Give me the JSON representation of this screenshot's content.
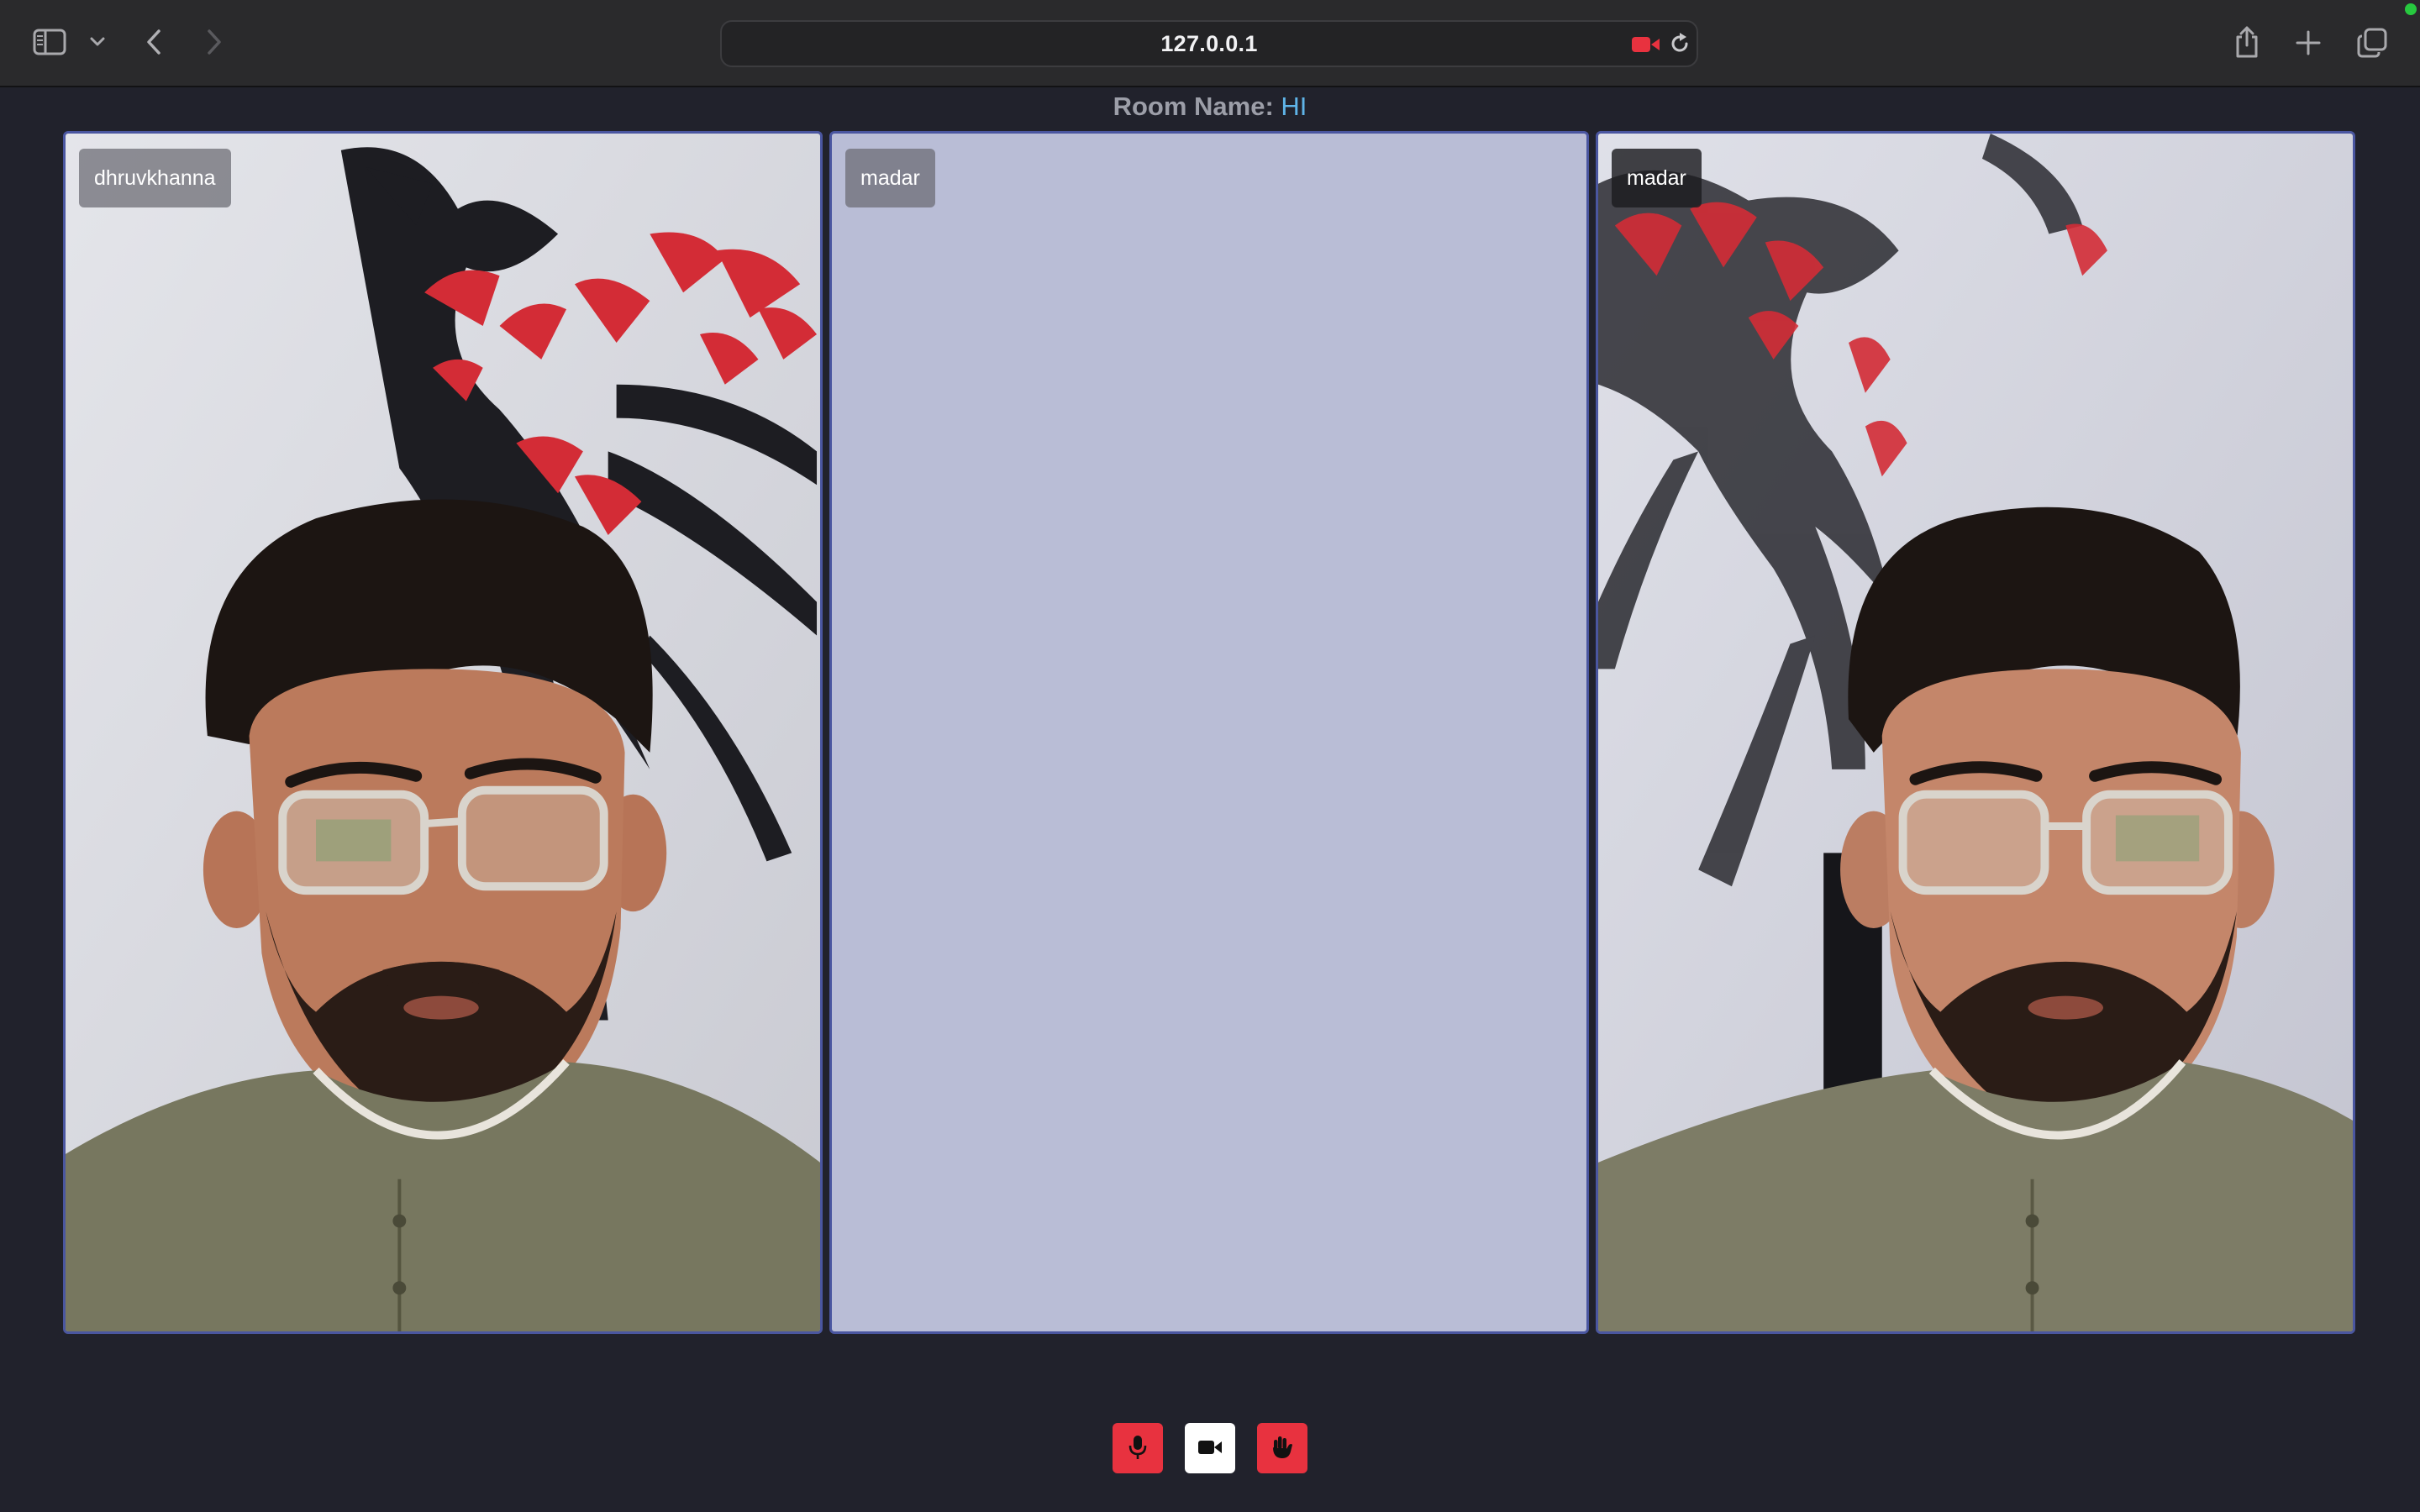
{
  "browser": {
    "url": "127.0.0.1",
    "icons": {
      "sidebar": "sidebar-icon",
      "tab_group_menu": "chevron-down-icon",
      "back": "chevron-left-icon",
      "forward": "chevron-right-icon",
      "camera_in_use": "video-camera-icon",
      "reload": "reload-icon",
      "share": "share-icon",
      "new_tab": "plus-icon",
      "tab_overview": "tabs-overview-icon"
    },
    "camera_indicator_color": "#e8323f",
    "status_dot_color": "#27c93f"
  },
  "room": {
    "label": "Room Name:",
    "name": "HI",
    "name_color": "#5fb4e8"
  },
  "participants": [
    {
      "name": "dhruvkhanna",
      "video": "on"
    },
    {
      "name": "madar",
      "video": "off",
      "placeholder_color": "#b9bdd6"
    },
    {
      "name": "madar",
      "video": "on"
    }
  ],
  "controls": {
    "mic": {
      "icon": "microphone-icon",
      "state": "muted",
      "color": "#e8323f"
    },
    "camera": {
      "icon": "video-camera-icon",
      "state": "on",
      "color": "#ffffff"
    },
    "raise_hand": {
      "icon": "hand-icon",
      "state": "active",
      "color": "#e8323f"
    }
  },
  "theme": {
    "background": "#21222c",
    "tile_border": "#4a56a0"
  }
}
